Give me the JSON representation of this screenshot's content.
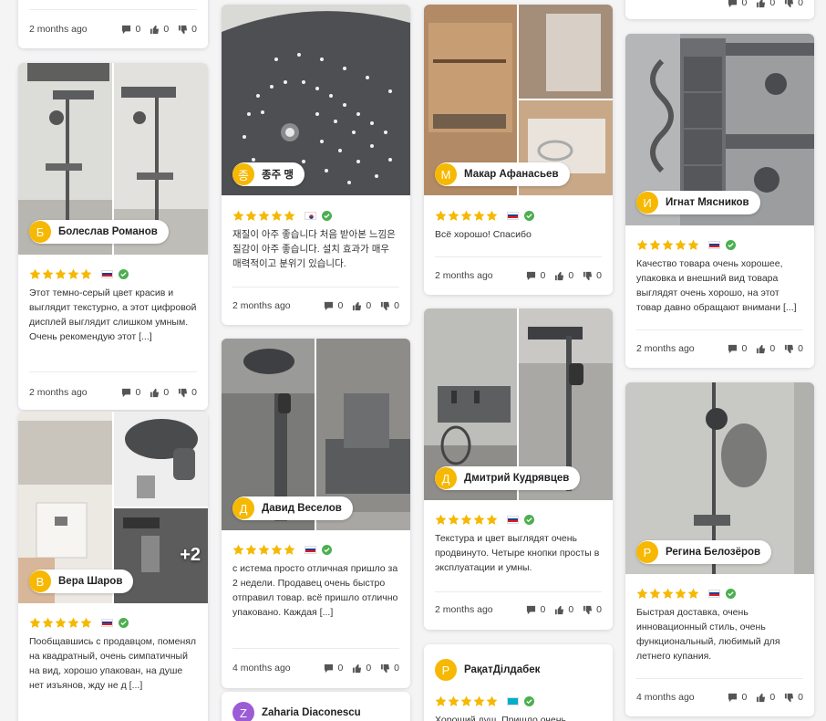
{
  "reviews": {
    "c1": {
      "date": "2 months ago",
      "comments": "0",
      "likes": "0",
      "dislikes": "0"
    },
    "c2": {
      "author": "Болеслав Романов",
      "initial": "Б",
      "text": "Этот темно-серый цвет красив и выглядит текстурно, а этот цифровой дисплей выглядит слишком умным. Очень рекомендую этот [...]",
      "date": "2 months ago",
      "comments": "0",
      "likes": "0",
      "dislikes": "0"
    },
    "c3": {
      "author": "Вера Шаров",
      "initial": "В",
      "more_photos": "+2",
      "text": "Пообщавшись с продавцом, поменял на квадратный, очень симпатичный на вид, хорошо упакован, на душе нет изъянов, жду не д [...]"
    },
    "c4": {
      "author": "종주 맹",
      "initial": "종",
      "text": "재질이 아주 좋습니다 처음 받아본 느낌은 질감이 아주 좋습니다. 설치 효과가 매우 매력적이고 분위기 있습니다.",
      "date": "2 months ago",
      "comments": "0",
      "likes": "0",
      "dislikes": "0"
    },
    "c5": {
      "author": "Давид Веселов",
      "initial": "Д",
      "text": "с истема просто отличная пришло за 2 недели. Продавец очень быстро отправил товар. всё пришло отлично упаковано. Каждая [...]",
      "date": "4 months ago",
      "comments": "0",
      "likes": "0",
      "dislikes": "0"
    },
    "c6": {
      "author": "Zaharia Diaconescu",
      "initial": "Z"
    },
    "c7": {
      "author": "Макар Афанасьев",
      "initial": "М",
      "text": "Всё хорошо! Спасибо",
      "date": "2 months ago",
      "comments": "0",
      "likes": "0",
      "dislikes": "0"
    },
    "c8": {
      "author": "Дмитрий Кудрявцев",
      "initial": "Д",
      "text": "Текстура и цвет выглядят очень продвинуто. Четыре кнопки просты в эксплуатации и умны.",
      "date": "2 months ago",
      "comments": "0",
      "likes": "0",
      "dislikes": "0"
    },
    "c9": {
      "author": "РақатДілдабек",
      "initial": "Р",
      "text": "Хороший душ. Пришло очень"
    },
    "c10": {
      "comments": "0",
      "likes": "0",
      "dislikes": "0"
    },
    "c11": {
      "author": "Игнат Мясников",
      "initial": "И",
      "text": "Качество товара очень хорошее, упаковка и внешний вид товара выглядят очень хорошо, на этот товар давно обращают внимани [...]",
      "date": "2 months ago",
      "comments": "0",
      "likes": "0",
      "dislikes": "0"
    },
    "c12": {
      "author": "Регина Белозёров",
      "initial": "Р",
      "text": "Быстрая доставка, очень инновационный стиль, очень функциональный, любимый для летнего купания.",
      "date": "4 months ago",
      "comments": "0",
      "likes": "0",
      "dislikes": "0"
    }
  },
  "rating": {
    "stars": 5
  },
  "colors": {
    "star": "#f6b800",
    "avatar": "#f6b800",
    "verified": "#4caf50",
    "card": "#ffffff",
    "page": "#f4f4f5"
  },
  "icons": {
    "comment": "comment-icon",
    "like": "thumbs-up-icon",
    "dislike": "thumbs-down-icon",
    "verified": "verified-check-icon",
    "flag": "country-flag-icon"
  }
}
